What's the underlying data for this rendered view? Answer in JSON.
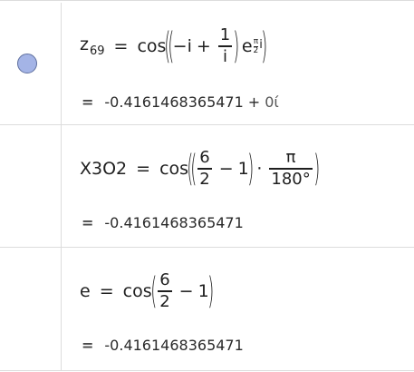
{
  "rows": [
    {
      "label": "z",
      "label_sub": "69",
      "equals": "=",
      "func": "cos",
      "term_sign": "−i",
      "plus": "+",
      "frac_num": "1",
      "frac_den": "i",
      "exp_base": "e",
      "exp_frac_num": "π",
      "exp_frac_den": "2",
      "exp_suffix": "i",
      "result_eq": "=",
      "result_value": "-0.4161468365471",
      "result_plus": "+",
      "result_imag": "0ί",
      "marble_color": "#a4b4e6"
    },
    {
      "label": "X3O2",
      "equals": "=",
      "func": "cos",
      "frac_num": "6",
      "frac_den": "2",
      "minus": "−",
      "one": "1",
      "dot": "·",
      "pi_num": "π",
      "pi_den": "180°",
      "result_eq": "=",
      "result_value": "-0.4161468365471"
    },
    {
      "label": "e",
      "equals": "=",
      "func": "cos",
      "frac_num": "6",
      "frac_den": "2",
      "minus": "−",
      "one": "1",
      "result_eq": "=",
      "result_value": "-0.4161468365471"
    }
  ]
}
